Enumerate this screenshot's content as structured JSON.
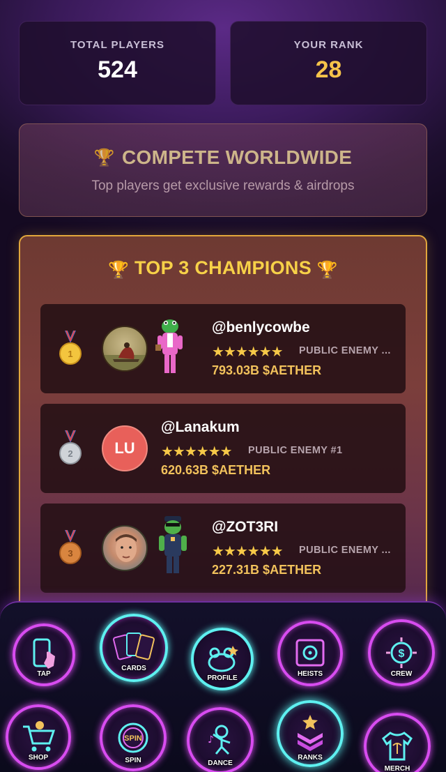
{
  "stats": {
    "total_label": "TOTAL PLAYERS",
    "total_value": "524",
    "rank_label": "YOUR RANK",
    "rank_value": "28"
  },
  "compete": {
    "title": "COMPETE WORLDWIDE",
    "subtitle": "Top players get exclusive rewards & airdrops",
    "icon": "trophy-icon"
  },
  "champions": {
    "title": "TOP 3 CHAMPIONS",
    "icon": "trophy-icon",
    "players": [
      {
        "place": 1,
        "medal": "gold-medal-icon",
        "name": "@benlycowbe",
        "stars": "★★★★★★",
        "rank_title": "PUBLIC ENEMY ...",
        "score": "793.03B $AETHER",
        "avatar": "painting-avatar",
        "has_character": true
      },
      {
        "place": 2,
        "medal": "silver-medal-icon",
        "name": "@Lanakum",
        "initials": "LU",
        "stars": "★★★★★★",
        "rank_title": "PUBLIC ENEMY #1",
        "score": "620.63B $AETHER",
        "avatar_color": "#e8605a",
        "has_character": false
      },
      {
        "place": 3,
        "medal": "bronze-medal-icon",
        "name": "@ZOT3RI",
        "stars": "★★★★★★",
        "rank_title": "PUBLIC ENEMY ...",
        "score": "227.31B $AETHER",
        "avatar": "photo-avatar",
        "has_character": true
      }
    ]
  },
  "nav": {
    "items": [
      {
        "label": "TAP",
        "icon": "phone-tap-icon"
      },
      {
        "label": "CARDS",
        "icon": "cards-icon"
      },
      {
        "label": "PROFILE",
        "icon": "frog-icon"
      },
      {
        "label": "HEISTS",
        "icon": "safe-icon"
      },
      {
        "label": "CREW",
        "icon": "coin-crew-icon"
      },
      {
        "label": "SHOP",
        "icon": "cart-icon"
      },
      {
        "label": "SPIN",
        "icon": "wheel-icon"
      },
      {
        "label": "DANCE",
        "icon": "dancing-frog-icon"
      },
      {
        "label": "RANKS",
        "icon": "chevron-rank-icon"
      },
      {
        "label": "MERCH",
        "icon": "shirt-icon"
      }
    ],
    "active": "RANKS"
  },
  "colors": {
    "accent_gold": "#f6c34a",
    "neon_pink": "#d84cf0",
    "neon_cyan": "#5ef0f0",
    "champion_border": "#e2a73c"
  }
}
